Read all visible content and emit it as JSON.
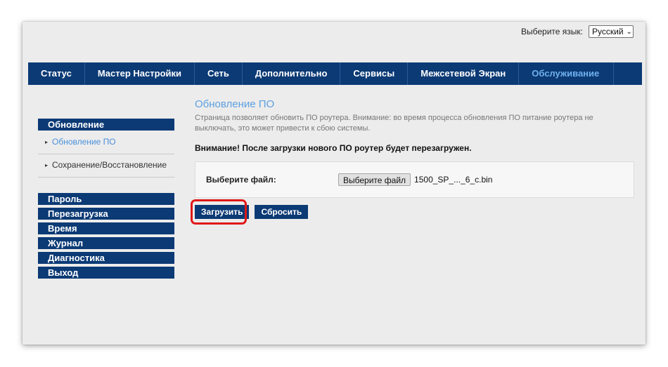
{
  "header": {
    "language_label": "Выберите язык:",
    "language_selected": "Русский"
  },
  "topnav": {
    "items": [
      {
        "label": "Статус"
      },
      {
        "label": "Мастер Настройки"
      },
      {
        "label": "Сеть"
      },
      {
        "label": "Дополнительно"
      },
      {
        "label": "Сервисы"
      },
      {
        "label": "Межсетевой Экран"
      },
      {
        "label": "Обслуживание"
      }
    ],
    "active_index": 6,
    "active_color": "#6fb1ee"
  },
  "sidebar": {
    "section_title": "Обновление",
    "sub_items": [
      {
        "label": "Обновление ПО"
      },
      {
        "label": "Сохранение/Восстановление"
      }
    ],
    "groups": [
      {
        "label": "Пароль"
      },
      {
        "label": "Перезагрузка"
      },
      {
        "label": "Время"
      },
      {
        "label": "Журнал"
      },
      {
        "label": "Диагностика"
      },
      {
        "label": "Выход"
      }
    ]
  },
  "main": {
    "title": "Обновление ПО",
    "description": "Страница позволяет обновить ПО роутера. Внимание: во время процесса обновления ПО питание роутера не выключать, это может привести к сбою системы.",
    "warning": "Внимание! После загрузки нового ПО роутер будет перезагружен.",
    "file_label": "Выберите файл:",
    "file_button": "Выберите файл",
    "file_name": "1500_SP_..._6_c.bin",
    "upload_button": "Загрузить",
    "reset_button": "Сбросить"
  },
  "colors": {
    "nav_bg": "#0b3a75",
    "title": "#5d9fdf",
    "highlight": "#e01818"
  }
}
